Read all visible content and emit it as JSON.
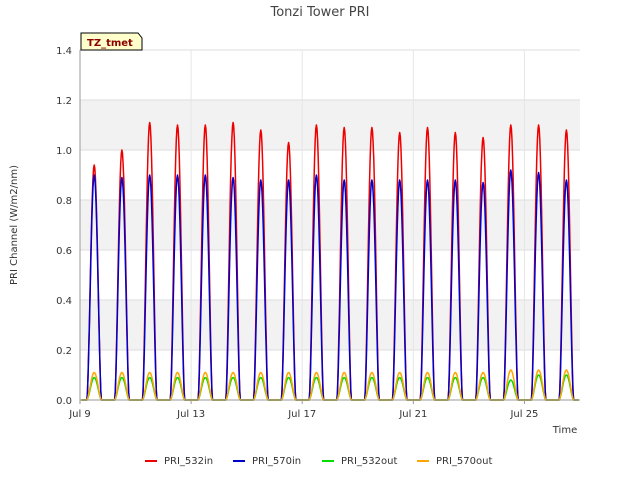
{
  "chart_data": {
    "type": "line",
    "title": "Tonzi Tower PRI",
    "xlabel": "Time",
    "ylabel": "PRI Channel (W/m2/nm)",
    "site_tag": "TZ_tmet",
    "xlim": [
      "2024-07-09",
      "2024-07-27"
    ],
    "ylim": [
      0,
      1.4
    ],
    "y_ticks": [
      0.0,
      0.2,
      0.4,
      0.6,
      0.8,
      1.0,
      1.2,
      1.4
    ],
    "y_tick_labels": [
      "0.0",
      "0.2",
      "0.4",
      "0.6",
      "0.8",
      "1.0",
      "1.2",
      "1.4"
    ],
    "x_ticks": [
      "2024-07-09",
      "2024-07-13",
      "2024-07-17",
      "2024-07-21",
      "2024-07-25"
    ],
    "x_tick_labels": [
      "Jul 9",
      "Jul 13",
      "Jul 17",
      "Jul 21",
      "Jul 25"
    ],
    "grid": true,
    "background_bands": true,
    "legend_position": "bottom",
    "series": [
      {
        "name": "PRI_532in",
        "color": "#ee0000",
        "daily_peak_dates": [
          "2024-07-09",
          "2024-07-10",
          "2024-07-11",
          "2024-07-12",
          "2024-07-13",
          "2024-07-14",
          "2024-07-15",
          "2024-07-16",
          "2024-07-17",
          "2024-07-18",
          "2024-07-19",
          "2024-07-20",
          "2024-07-21",
          "2024-07-22",
          "2024-07-23",
          "2024-07-24",
          "2024-07-25",
          "2024-07-26"
        ],
        "daily_peaks": [
          0.94,
          1.0,
          1.11,
          1.1,
          1.1,
          1.11,
          1.08,
          1.03,
          1.1,
          1.09,
          1.09,
          1.07,
          1.09,
          1.07,
          1.05,
          1.1,
          1.1,
          1.08
        ]
      },
      {
        "name": "PRI_570in",
        "color": "#0000cc",
        "daily_peak_dates": [
          "2024-07-09",
          "2024-07-10",
          "2024-07-11",
          "2024-07-12",
          "2024-07-13",
          "2024-07-14",
          "2024-07-15",
          "2024-07-16",
          "2024-07-17",
          "2024-07-18",
          "2024-07-19",
          "2024-07-20",
          "2024-07-21",
          "2024-07-22",
          "2024-07-23",
          "2024-07-24",
          "2024-07-25",
          "2024-07-26"
        ],
        "daily_peaks": [
          0.9,
          0.89,
          0.9,
          0.9,
          0.9,
          0.89,
          0.88,
          0.88,
          0.9,
          0.88,
          0.88,
          0.88,
          0.88,
          0.88,
          0.87,
          0.92,
          0.91,
          0.88
        ]
      },
      {
        "name": "PRI_532out",
        "color": "#00dd00",
        "daily_peak_dates": [
          "2024-07-09",
          "2024-07-10",
          "2024-07-11",
          "2024-07-12",
          "2024-07-13",
          "2024-07-14",
          "2024-07-15",
          "2024-07-16",
          "2024-07-17",
          "2024-07-18",
          "2024-07-19",
          "2024-07-20",
          "2024-07-21",
          "2024-07-22",
          "2024-07-23",
          "2024-07-24",
          "2024-07-25",
          "2024-07-26"
        ],
        "daily_peaks": [
          0.09,
          0.09,
          0.09,
          0.09,
          0.09,
          0.09,
          0.09,
          0.09,
          0.09,
          0.09,
          0.09,
          0.09,
          0.09,
          0.09,
          0.09,
          0.08,
          0.1,
          0.1
        ]
      },
      {
        "name": "PRI_570out",
        "color": "#ffa500",
        "daily_peak_dates": [
          "2024-07-09",
          "2024-07-10",
          "2024-07-11",
          "2024-07-12",
          "2024-07-13",
          "2024-07-14",
          "2024-07-15",
          "2024-07-16",
          "2024-07-17",
          "2024-07-18",
          "2024-07-19",
          "2024-07-20",
          "2024-07-21",
          "2024-07-22",
          "2024-07-23",
          "2024-07-24",
          "2024-07-25",
          "2024-07-26"
        ],
        "daily_peaks": [
          0.11,
          0.11,
          0.11,
          0.11,
          0.11,
          0.11,
          0.11,
          0.11,
          0.11,
          0.11,
          0.11,
          0.11,
          0.11,
          0.11,
          0.11,
          0.12,
          0.12,
          0.12
        ]
      }
    ]
  }
}
